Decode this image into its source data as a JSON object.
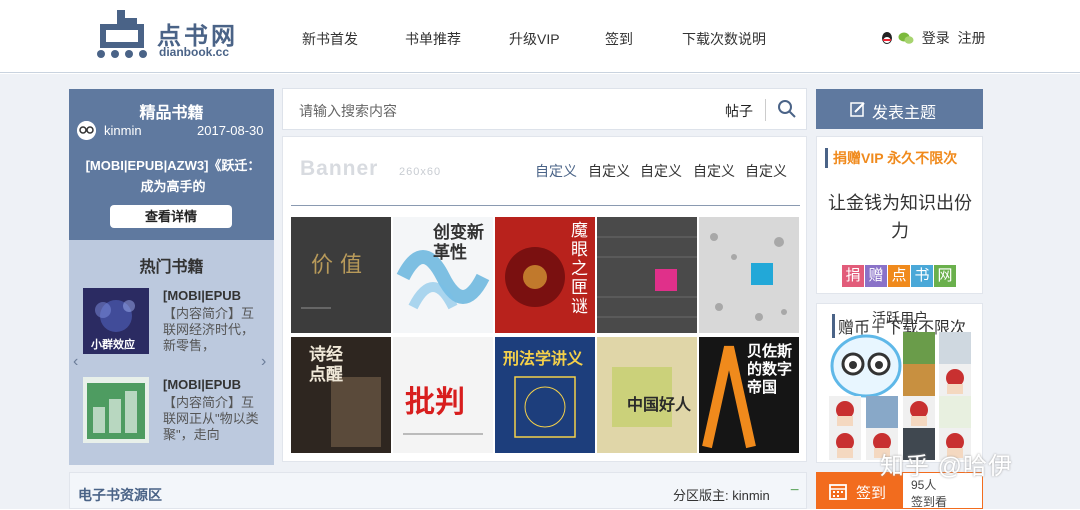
{
  "header": {
    "logo_cn": "点书网",
    "logo_en": "dianbook.cc",
    "nav": [
      "新书首发",
      "书单推荐",
      "升级VIP",
      "签到",
      "下载次数说明"
    ],
    "login": "登录",
    "register": "注册"
  },
  "featured": {
    "title": "精品书籍",
    "author": "kinmin",
    "date": "2017-08-30",
    "book_title": "[MOBI|EPUB|AZW3]《跃迁：成为高手的",
    "button": "查看详情"
  },
  "hot": {
    "title": "热门书籍",
    "items": [
      {
        "title": "[MOBI|EPUB",
        "desc": "【内容简介】互联网经济时代，新零售，",
        "cover_text": "小群效应",
        "cover_color": "#2a2a5e"
      },
      {
        "title": "[MOBI|EPUB",
        "desc": "【内容简介】互联网正从\"物以类聚\"，走向",
        "cover_text": "",
        "cover_color": "#4e9c61"
      }
    ]
  },
  "search": {
    "placeholder": "请输入搜索内容",
    "type": "帖子"
  },
  "banner": {
    "label": "Banner",
    "size": "260x60",
    "custom_links": [
      "自定义",
      "自定义",
      "自定义",
      "自定义",
      "自定义"
    ]
  },
  "books": [
    {
      "text": "价 值",
      "bg": "#3c3c3c",
      "fg": "#b89a5a"
    },
    {
      "text": "创变新革性",
      "bg": "#f4f6f8",
      "fg": "#333333"
    },
    {
      "text": "魔眼之匣谜",
      "bg": "#b8221c",
      "fg": "#ffffff"
    },
    {
      "text": "",
      "bg": "#4a4a4a",
      "fg": "#e0308a"
    },
    {
      "text": "",
      "bg": "#d8d8d8",
      "fg": "#22a8d8"
    },
    {
      "text": "诗经点醒",
      "bg": "#2e2620",
      "fg": "#f0e8d8"
    },
    {
      "text": "批判",
      "bg": "#f4f4f4",
      "fg": "#d81e1e"
    },
    {
      "text": "刑法学讲义",
      "bg": "#1d3e7c",
      "fg": "#f4d04a"
    },
    {
      "text": "中国好人",
      "bg": "#e0d6a8",
      "fg": "#2a2a2a"
    },
    {
      "text": "贝佐斯的数字帝国",
      "bg": "#151515",
      "fg": "#f08a1c"
    }
  ],
  "strip": {
    "title": "电子书资源区",
    "moderator": "分区版主: kinmin",
    "collapse": "−"
  },
  "post": {
    "label": "发表主题"
  },
  "donate": {
    "title": "捐赠VIP 永久不限次",
    "slogan": "让金钱为知识出份力",
    "chars": [
      "捐",
      "赠",
      "点",
      "书",
      "网"
    ],
    "char_colors": [
      "#e25c7a",
      "#8a72c8",
      "#f08a1c",
      "#4aa8d8",
      "#6ab04c"
    ]
  },
  "coins": {
    "title": "赠币＋下载不限次",
    "overlay": "活跃用户"
  },
  "checkin": {
    "label": "签到",
    "count": "95人",
    "view": "签到看"
  },
  "watermark": "知乎 @哈伊"
}
